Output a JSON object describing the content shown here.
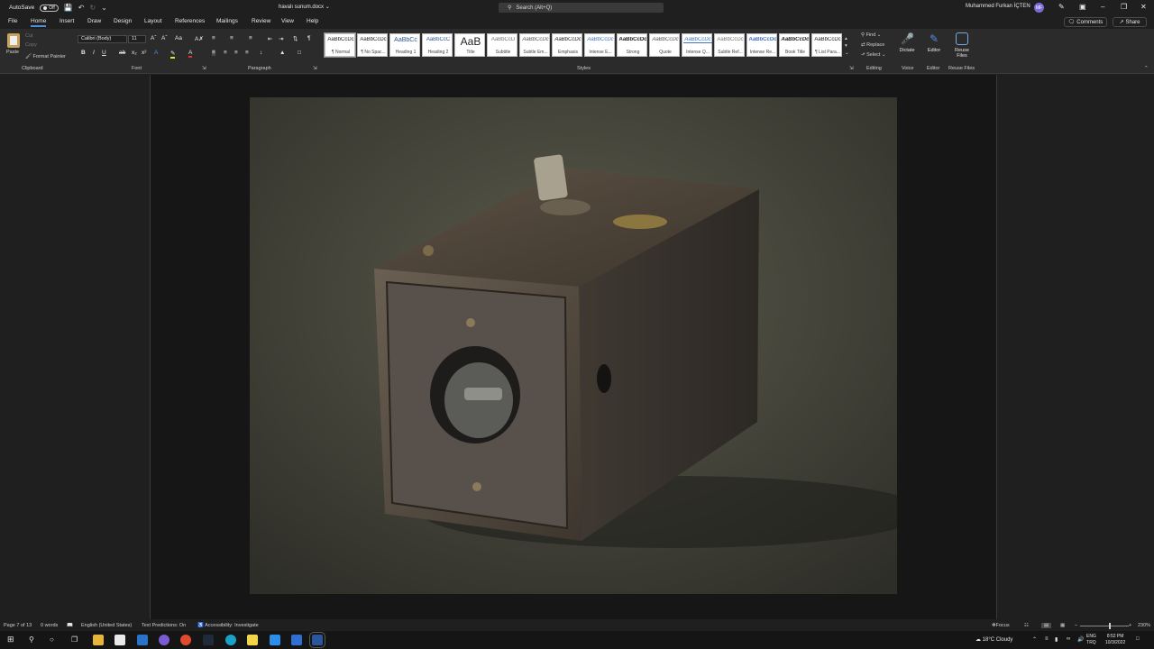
{
  "titlebar": {
    "autosave_label": "AutoSave",
    "autosave_state": "Off",
    "doc_title": "havalı sunum.docx",
    "search_placeholder": "Search (Alt+Q)",
    "user_name": "Muhammed Furkan İÇTEN",
    "user_initials": "MF"
  },
  "menu": {
    "tabs": [
      "File",
      "Home",
      "Insert",
      "Draw",
      "Design",
      "Layout",
      "References",
      "Mailings",
      "Review",
      "View",
      "Help"
    ],
    "active": "Home",
    "comments_label": "Comments",
    "share_label": "Share"
  },
  "ribbon": {
    "clipboard": {
      "paste": "Paste",
      "cut": "Cut",
      "copy": "Copy",
      "format_painter": "Format Painter",
      "label": "Clipboard"
    },
    "font": {
      "family": "Calibri (Body)",
      "size": "11",
      "label": "Font"
    },
    "paragraph": {
      "label": "Paragraph"
    },
    "styles": {
      "label": "Styles",
      "items": [
        {
          "sample": "AaBbCcDc",
          "name": "¶ Normal"
        },
        {
          "sample": "AaBbCcDc",
          "name": "¶ No Spac..."
        },
        {
          "sample": "AaBbCc",
          "name": "Heading 1"
        },
        {
          "sample": "AaBbCcC",
          "name": "Heading 2"
        },
        {
          "sample": "AaB",
          "name": "Title"
        },
        {
          "sample": "AaBbCcD",
          "name": "Subtitle"
        },
        {
          "sample": "AaBbCcDc",
          "name": "Subtle Em..."
        },
        {
          "sample": "AaBbCcDc",
          "name": "Emphasis"
        },
        {
          "sample": "AaBbCcDc",
          "name": "Intense E..."
        },
        {
          "sample": "AaBbCcDc",
          "name": "Strong"
        },
        {
          "sample": "AaBbCcDc",
          "name": "Quote"
        },
        {
          "sample": "AaBbCcDc",
          "name": "Intense Q..."
        },
        {
          "sample": "AaBbCcDc",
          "name": "Subtle Ref..."
        },
        {
          "sample": "AaBbCcDc",
          "name": "Intense Re..."
        },
        {
          "sample": "AaBbCcDc",
          "name": "Book Title"
        },
        {
          "sample": "AaBbCcDc",
          "name": "¶ List Para..."
        }
      ]
    },
    "editing": {
      "find": "Find",
      "replace": "Replace",
      "select": "Select",
      "label": "Editing"
    },
    "voice": {
      "dictate": "Dictate",
      "label": "Voice"
    },
    "editor": {
      "editor": "Editor",
      "label": "Editor"
    },
    "reuse": {
      "reuse_files": "Reuse Files",
      "label": "Reuse Files"
    }
  },
  "document": {
    "image_alt": "Vintage box camera photograph"
  },
  "statusbar": {
    "page": "Page 7 of 13",
    "words": "0 words",
    "language": "English (United States)",
    "text_predictions": "Text Predictions: On",
    "accessibility": "Accessibility: Investigate",
    "focus": "Focus",
    "zoom": "230%"
  },
  "taskbar": {
    "weather": "18°C  Cloudy",
    "lang_top": "ENG",
    "lang_bottom": "TRQ",
    "time": "8:52 PM",
    "date": "10/3/2022"
  },
  "colors": {
    "accent": "#4e8ede",
    "ribbon_bg": "#2b2b2b",
    "chrome_bg": "#1f1f1f"
  }
}
